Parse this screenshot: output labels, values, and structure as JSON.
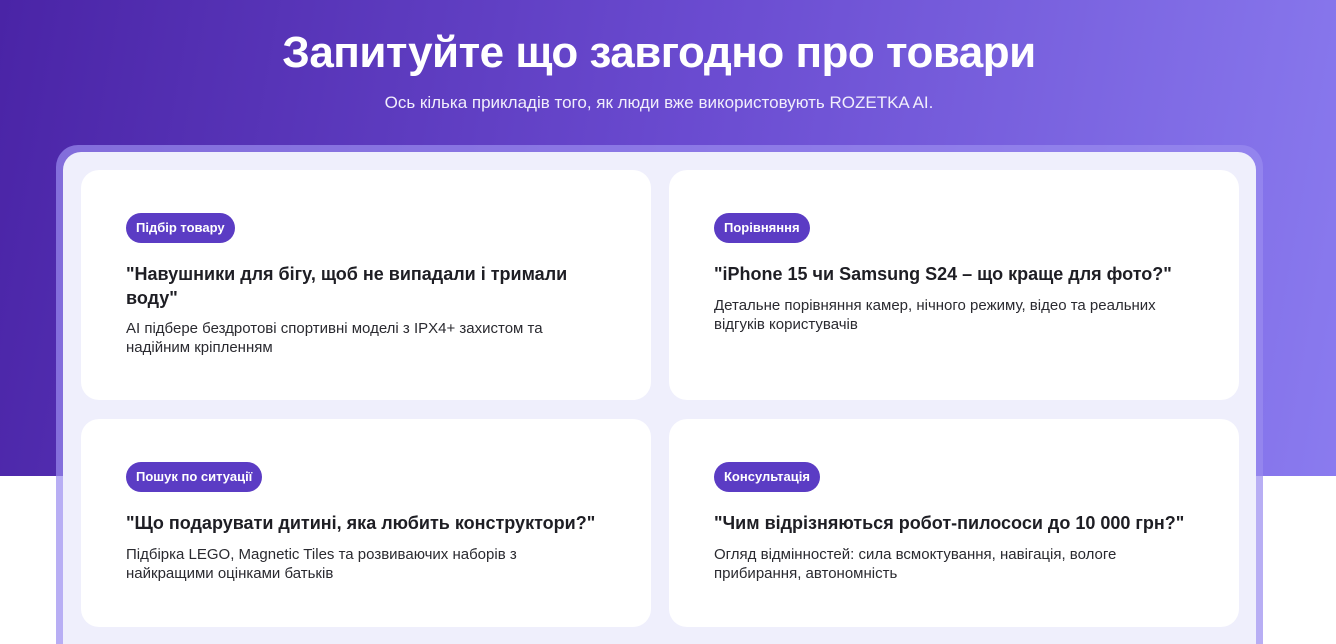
{
  "header": {
    "title": "Запитуйте що завгодно про товари",
    "subtitle": "Ось кілька прикладів того, як люди вже використовують ROZETKA AI."
  },
  "cards": [
    {
      "badge": "Підбір товару",
      "question": "\"Навушники для бігу, щоб не випадали і тримали воду\"",
      "description": "AI підбере бездротові спортивні моделі з IPX4+ захистом та надійним кріпленням"
    },
    {
      "badge": "Порівняння",
      "question": "\"iPhone 15 чи Samsung S24 – що краще для фото?\"",
      "description": "Детальне порівняння камер, нічного режиму, відео та реальних відгуків користувачів"
    },
    {
      "badge": "Пошук по ситуації",
      "question": "\"Що подарувати дитині, яка любить конструктори?\"",
      "description": "Підбірка LEGO, Magnetic Tiles та розвиваючих наборів з найкращими оцінками батьків"
    },
    {
      "badge": "Консультація",
      "question": "\"Чим відрізняються робот-пилососи до 10 000 грн?\"",
      "description": "Огляд відмінностей: сила всмоктування, навігація, вологе прибирання, автономність"
    }
  ],
  "colors": {
    "gradient_start": "#4a24a6",
    "gradient_end": "#8a7bef",
    "badge": "#5b3cc4",
    "panel": "#efeffc"
  }
}
